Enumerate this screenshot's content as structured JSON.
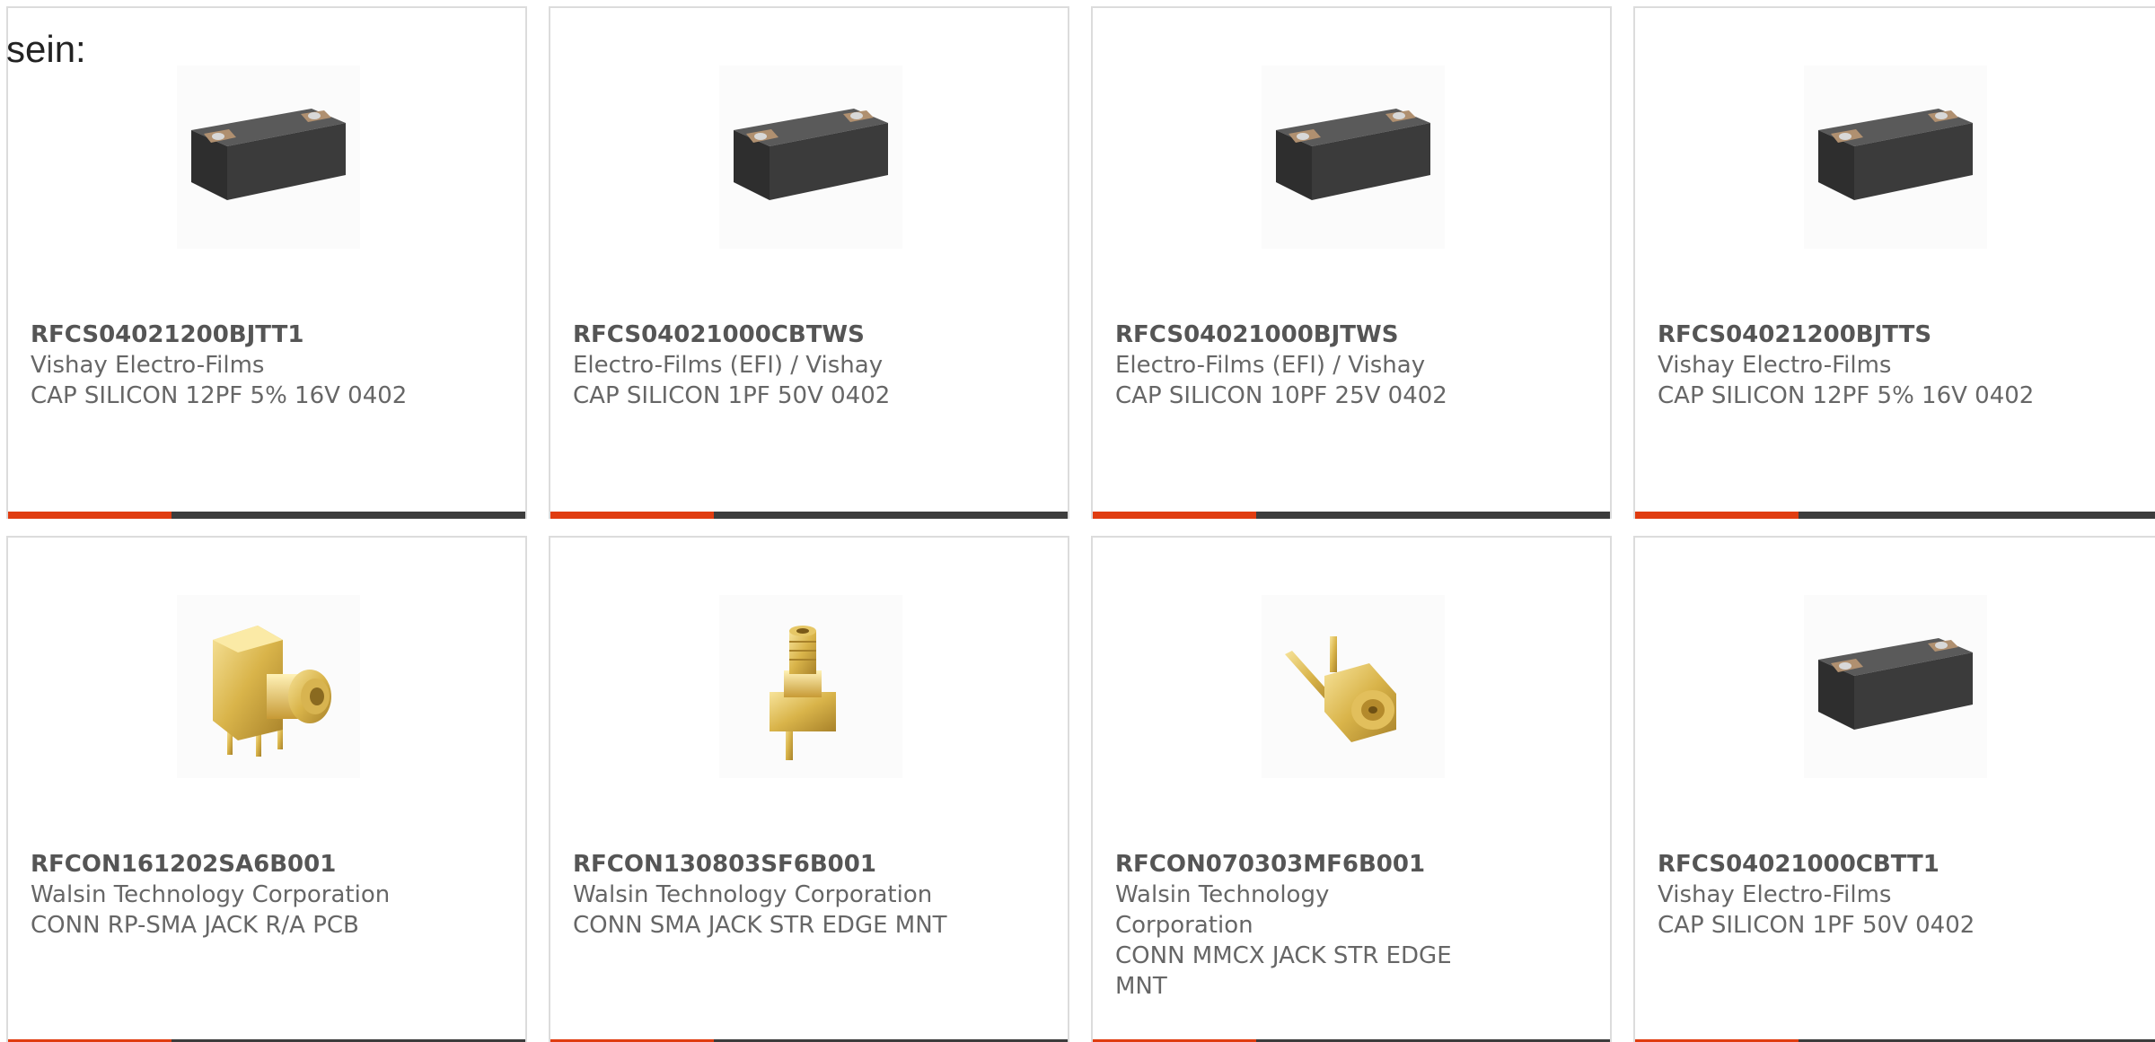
{
  "intro_text": "sein:",
  "colors": {
    "accent": "#e03c10",
    "bar": "#3c3c3c",
    "card_border": "#dcdcdc",
    "text": "#666666"
  },
  "products": [
    {
      "part_number": "RFCS04021200BJTT1",
      "manufacturer": "Vishay Electro-Films",
      "description": "CAP SILICON 12PF 5% 16V 0402",
      "image_icon": "silicon-capacitor-chip-icon"
    },
    {
      "part_number": "RFCS04021000CBTWS",
      "manufacturer": "Electro-Films (EFI) / Vishay",
      "description": "CAP SILICON 1PF 50V 0402",
      "image_icon": "silicon-capacitor-chip-icon"
    },
    {
      "part_number": "RFCS04021000BJTWS",
      "manufacturer": "Electro-Films (EFI) / Vishay",
      "description": "CAP SILICON 10PF 25V 0402",
      "image_icon": "silicon-capacitor-chip-icon"
    },
    {
      "part_number": "RFCS04021200BJTTS",
      "manufacturer": "Vishay Electro-Films",
      "description": "CAP SILICON 12PF 5% 16V 0402",
      "image_icon": "silicon-capacitor-chip-icon"
    },
    {
      "part_number": "RFCON161202SA6B001",
      "manufacturer": "Walsin Technology Corporation",
      "description": "CONN RP-SMA JACK R/A PCB",
      "image_icon": "rp-sma-right-angle-connector-icon"
    },
    {
      "part_number": "RFCON130803SF6B001",
      "manufacturer": "Walsin Technology Corporation",
      "description": "CONN SMA JACK STR EDGE MNT",
      "image_icon": "sma-edge-mount-connector-icon"
    },
    {
      "part_number": "RFCON070303MF6B001",
      "manufacturer": "Walsin Technology Corporation",
      "description": "CONN MMCX JACK STR EDGE MNT",
      "image_icon": "mmcx-edge-mount-connector-icon"
    },
    {
      "part_number": "RFCS04021000CBTT1",
      "manufacturer": "Vishay Electro-Films",
      "description": "CAP SILICON 1PF 50V 0402",
      "image_icon": "silicon-capacitor-chip-icon"
    }
  ]
}
